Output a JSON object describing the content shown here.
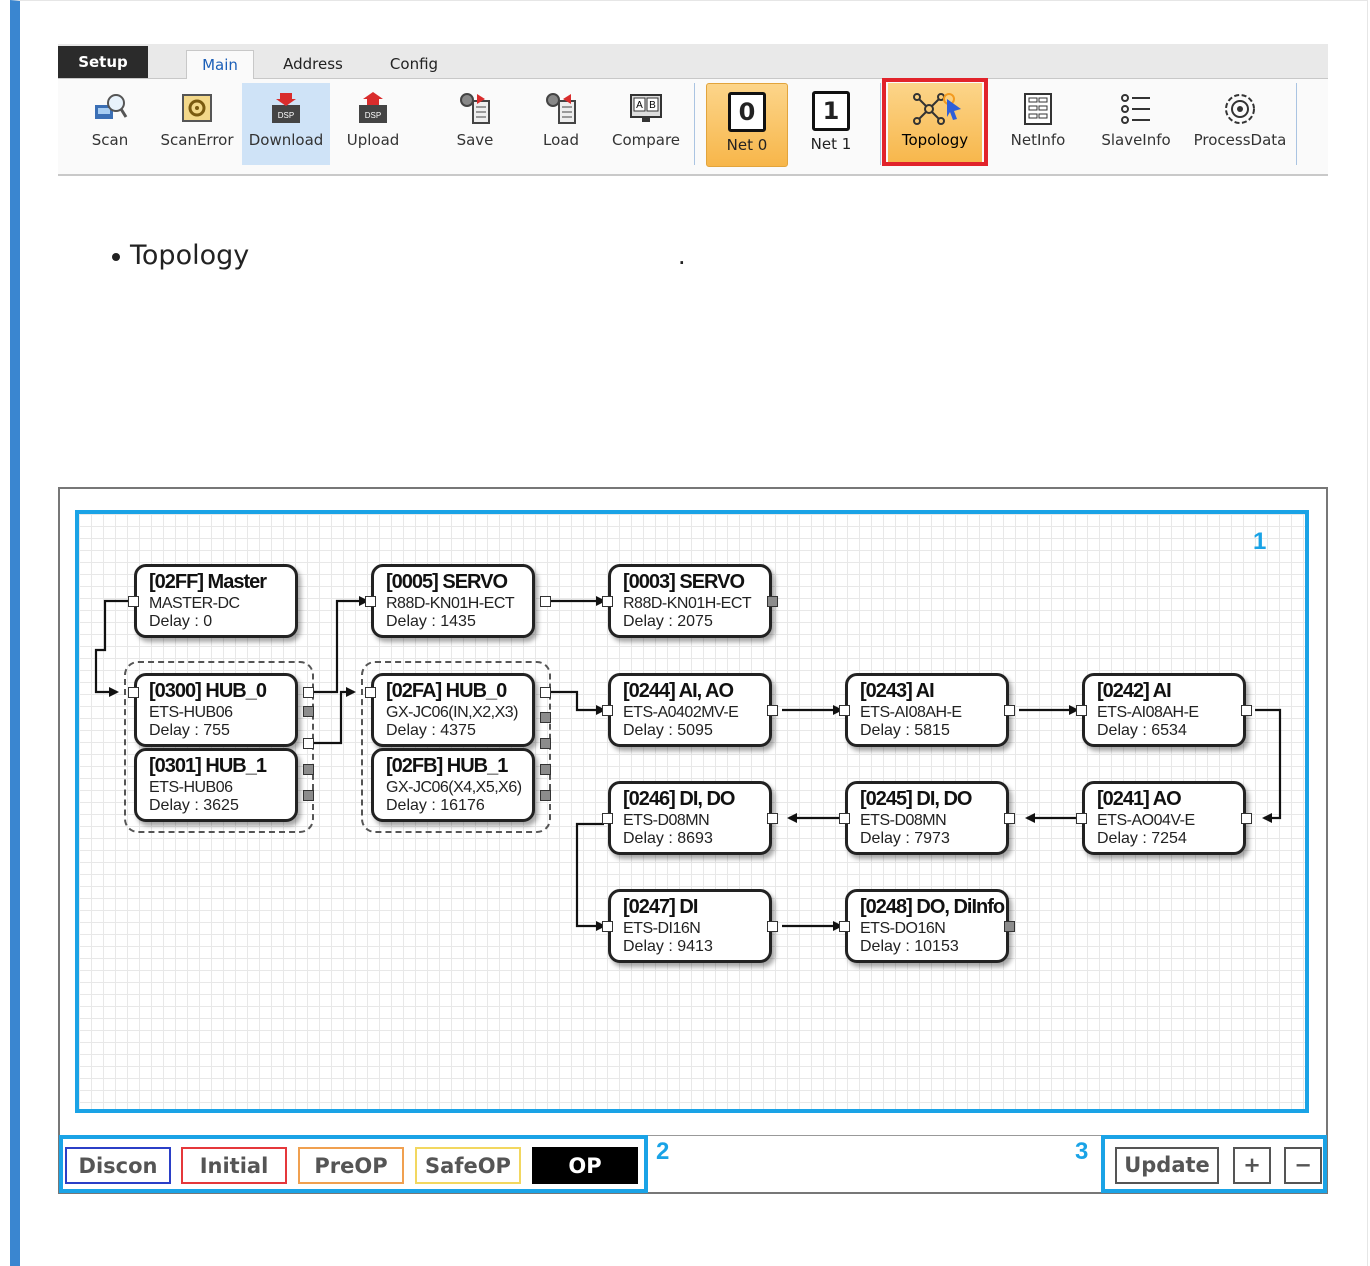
{
  "ribbon": {
    "tabs": {
      "setup": "Setup",
      "main": "Main",
      "address": "Address",
      "config": "Config"
    },
    "buttons": {
      "scan": "Scan",
      "scan_error": "ScanError",
      "download": "Download",
      "upload": "Upload",
      "save": "Save",
      "load": "Load",
      "compare": "Compare",
      "net0_num": "0",
      "net0": "Net 0",
      "net1_num": "1",
      "net1": "Net 1",
      "topology": "Topology",
      "netinfo": "NetInfo",
      "slaveinfo": "SlaveInfo",
      "processdata": "ProcessData"
    }
  },
  "description": {
    "text": "Topology",
    "trail": "."
  },
  "areas": {
    "canvas": "1",
    "state": "2",
    "controls": "3"
  },
  "nodes": [
    {
      "title": "[02FF] Master",
      "model": "MASTER-DC",
      "delay": "Delay : 0"
    },
    {
      "title": "[0300] HUB_0",
      "model": "ETS-HUB06",
      "delay": "Delay : 755"
    },
    {
      "title": "[0301] HUB_1",
      "model": "ETS-HUB06",
      "delay": "Delay : 3625"
    },
    {
      "title": "[0005] SERVO",
      "model": "R88D-KN01H-ECT",
      "delay": "Delay : 1435"
    },
    {
      "title": "[02FA] HUB_0",
      "model": "GX-JC06(IN,X2,X3)",
      "delay": "Delay : 4375"
    },
    {
      "title": "[02FB] HUB_1",
      "model": "GX-JC06(X4,X5,X6)",
      "delay": "Delay : 16176"
    },
    {
      "title": "[0003] SERVO",
      "model": "R88D-KN01H-ECT",
      "delay": "Delay : 2075"
    },
    {
      "title": "[0244] AI, AO",
      "model": "ETS-A0402MV-E",
      "delay": "Delay : 5095"
    },
    {
      "title": "[0243] AI",
      "model": "ETS-AI08AH-E",
      "delay": "Delay : 5815"
    },
    {
      "title": "[0242] AI",
      "model": "ETS-AI08AH-E",
      "delay": "Delay : 6534"
    },
    {
      "title": "[0246] DI, DO",
      "model": "ETS-D08MN",
      "delay": "Delay : 8693"
    },
    {
      "title": "[0245] DI, DO",
      "model": "ETS-D08MN",
      "delay": "Delay : 7973"
    },
    {
      "title": "[0241] AO",
      "model": "ETS-AO04V-E",
      "delay": "Delay : 7254"
    },
    {
      "title": "[0247] DI",
      "model": "ETS-DI16N",
      "delay": "Delay : 9413"
    },
    {
      "title": "[0248] DO, DiInfo",
      "model": "ETS-DO16N",
      "delay": "Delay : 10153"
    }
  ],
  "states": [
    {
      "label": "Discon",
      "color": "#2b3fc7"
    },
    {
      "label": "Initial",
      "color": "#e5383b"
    },
    {
      "label": "PreOP",
      "color": "#f0a050"
    },
    {
      "label": "SafeOP",
      "color": "#f2d760"
    },
    {
      "label": "OP",
      "color": "#000000"
    }
  ],
  "controls": {
    "update": "Update",
    "zoom_in": "+",
    "zoom_out": "−"
  },
  "colors": {
    "accent": "#1aa3e6",
    "highlight": "#e1232b",
    "frame": "#3a86d0"
  }
}
